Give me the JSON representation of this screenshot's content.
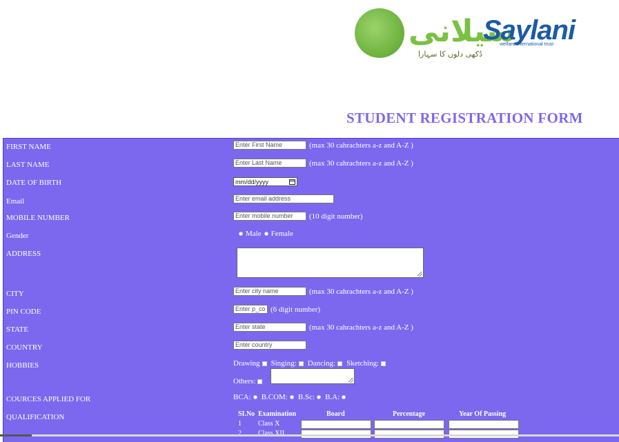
{
  "logo": {
    "urdu": "سیلانی",
    "brand": "Saylani",
    "subtitle": "welfare international trust",
    "tagline": "دُکھی دلوں کا سہارا"
  },
  "page_title": "STUDENT REGISTRATION FORM",
  "colors": {
    "panel": "#7b68ee",
    "title": "#7b68ee",
    "logo_blue": "#1c5aa6",
    "logo_green": "#7ac143"
  },
  "fields": {
    "first_name": {
      "label": "FIRST NAME",
      "placeholder": "Enter First Name",
      "hint": "(max 30 cahrachters a-z and A-Z )"
    },
    "last_name": {
      "label": "LAST NAME",
      "placeholder": "Enter Last Name",
      "hint": "(max 30 cahrachters a-z and A-Z )"
    },
    "dob": {
      "label": "DATE OF BIRTH",
      "value": "mm/dd/yyyy"
    },
    "email": {
      "label": "Email",
      "placeholder": "Enter email address"
    },
    "mobile": {
      "label": "MOBILE NUMBER",
      "placeholder": "Enter mobile number",
      "hint": "(10 digit number)"
    },
    "gender": {
      "label": "Gender",
      "options": [
        "Male",
        "Female"
      ]
    },
    "address": {
      "label": "ADDRESS"
    },
    "city": {
      "label": "CITY",
      "placeholder": "Enter city name",
      "hint": "(max 30 cahrachters a-z and A-Z )"
    },
    "pin": {
      "label": "PIN CODE",
      "placeholder": "Enter p_co",
      "hint": "(6 digit number)"
    },
    "state": {
      "label": "STATE",
      "placeholder": "Enter state",
      "hint": "(max 30 cahrachters a-z and A-Z )"
    },
    "country": {
      "label": "COUNTRY",
      "placeholder": "Enter country"
    },
    "hobbies": {
      "label": "HOBBIES",
      "options": [
        "Drawing",
        "Singing:",
        "Dancing:",
        "Sketching:"
      ],
      "others": "Others:"
    },
    "courses": {
      "label": "COURCES APPLIED FOR",
      "options": [
        "BCA:",
        "B.COM:",
        "B.Sc:",
        "B.A:"
      ]
    },
    "qualification": {
      "label": "QUALIFICATION",
      "headers": [
        "SI.No",
        "Examination",
        "Board",
        "Percentage",
        "Year Of Passing"
      ],
      "rows": [
        {
          "no": "1",
          "exam": "Class X"
        },
        {
          "no": "2",
          "exam": "Class XII"
        }
      ]
    }
  }
}
